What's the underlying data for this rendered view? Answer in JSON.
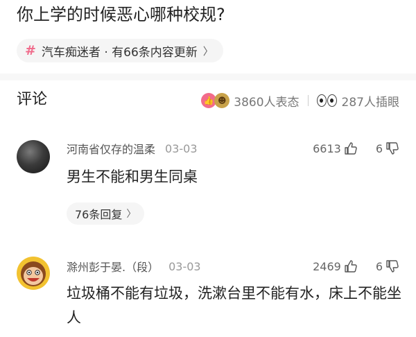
{
  "post": {
    "title": "你上学的时候恶心哪种校规?",
    "topic": {
      "icon": "hash-icon",
      "label": "汽车痴迷者 · 有66条内容更新"
    }
  },
  "comments_section": {
    "title": "评论",
    "reactions_count": "3860人表态",
    "views_count": "287人插眼",
    "accent_color": "#f26b8a"
  },
  "comments": [
    {
      "username": "河南省仅存的温柔",
      "date": "03-03",
      "likes": "6613",
      "dislikes": "6",
      "text": "男生不能和男生同桌",
      "replies_label": "76条回复"
    },
    {
      "username": "滁州彭于晏.（段）",
      "date": "03-03",
      "likes": "2469",
      "dislikes": "6",
      "text": "垃圾桶不能有垃圾，洗漱台里不能有水，床上不能坐人"
    }
  ]
}
